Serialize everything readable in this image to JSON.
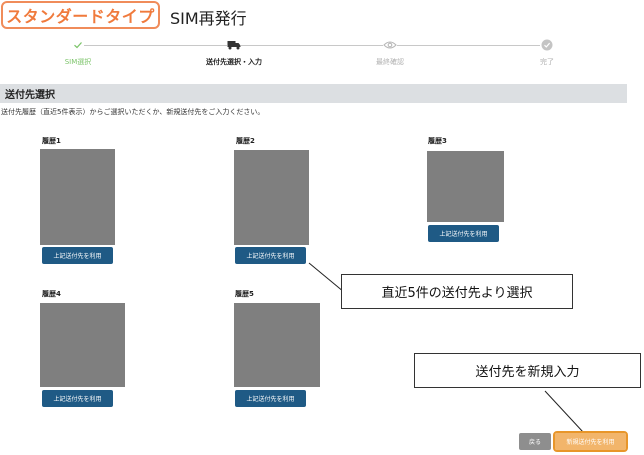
{
  "header": {
    "plan_badge": "スタンダードタイプ",
    "title": "SIM再発行"
  },
  "stepper": {
    "steps": [
      {
        "label": "SIM選択",
        "state": "done",
        "icon": "check-icon"
      },
      {
        "label": "送付先選択・入力",
        "state": "active",
        "icon": "truck-icon"
      },
      {
        "label": "最終確認",
        "state": "todo",
        "icon": "eye-icon"
      },
      {
        "label": "完了",
        "state": "todo",
        "icon": "check-circle-icon"
      }
    ]
  },
  "section": {
    "title": "送付先選択",
    "instruction": "送付先履歴（直近5件表示）からご選択いただくか、新規送付先をご入力ください。"
  },
  "history": [
    {
      "label": "履歴1",
      "button": "上記送付先を利用"
    },
    {
      "label": "履歴2",
      "button": "上記送付先を利用"
    },
    {
      "label": "履歴3",
      "button": "上記送付先を利用"
    },
    {
      "label": "履歴4",
      "button": "上記送付先を利用"
    },
    {
      "label": "履歴5",
      "button": "上記送付先を利用"
    }
  ],
  "callouts": {
    "history_note": "直近5件の送付先より選択",
    "new_note": "送付先を新規入力"
  },
  "footer": {
    "back_label": "戻る",
    "new_label": "新規送付先を利用"
  },
  "colors": {
    "accent_orange": "#f07a3c",
    "primary_button": "#1f5a85",
    "new_button": "#f2b56b",
    "done_green": "#7cc46a"
  }
}
